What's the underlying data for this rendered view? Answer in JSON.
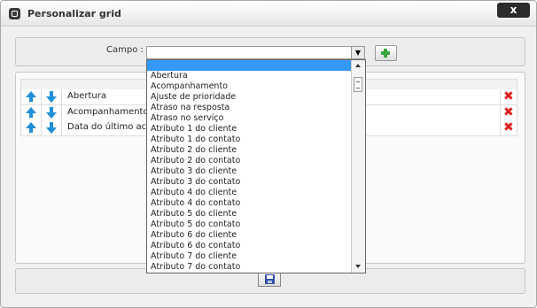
{
  "window": {
    "title": "Personalizar grid",
    "close_label": "x"
  },
  "filter": {
    "label": "Campo :",
    "selected_value": "",
    "add_icon": "plus-icon"
  },
  "grid": {
    "rows": [
      {
        "label": "Abertura"
      },
      {
        "label": "Acompanhamento"
      },
      {
        "label": "Data do último ac"
      }
    ]
  },
  "dropdown": {
    "options": [
      "Abertura",
      "Acompanhamento",
      "Ajuste de prioridade",
      "Atraso na resposta",
      "Atraso no serviço",
      "Atributo 1 do cliente",
      "Atributo 1 do contato",
      "Atributo 2 do cliente",
      "Atributo 2 do contato",
      "Atributo 3 do cliente",
      "Atributo 3 do contato",
      "Atributo 4 do cliente",
      "Atributo 4 do contato",
      "Atributo 5 do cliente",
      "Atributo 5 do contato",
      "Atributo 6 do cliente",
      "Atributo 6 do contato",
      "Atributo 7 do cliente",
      "Atributo 7 do contato"
    ]
  },
  "footer": {
    "save_icon": "save-disk-icon"
  },
  "colors": {
    "highlight": "#3399ff",
    "arrow": "#1f8fd8",
    "delete": "#e02020",
    "add": "#3aa53a"
  }
}
